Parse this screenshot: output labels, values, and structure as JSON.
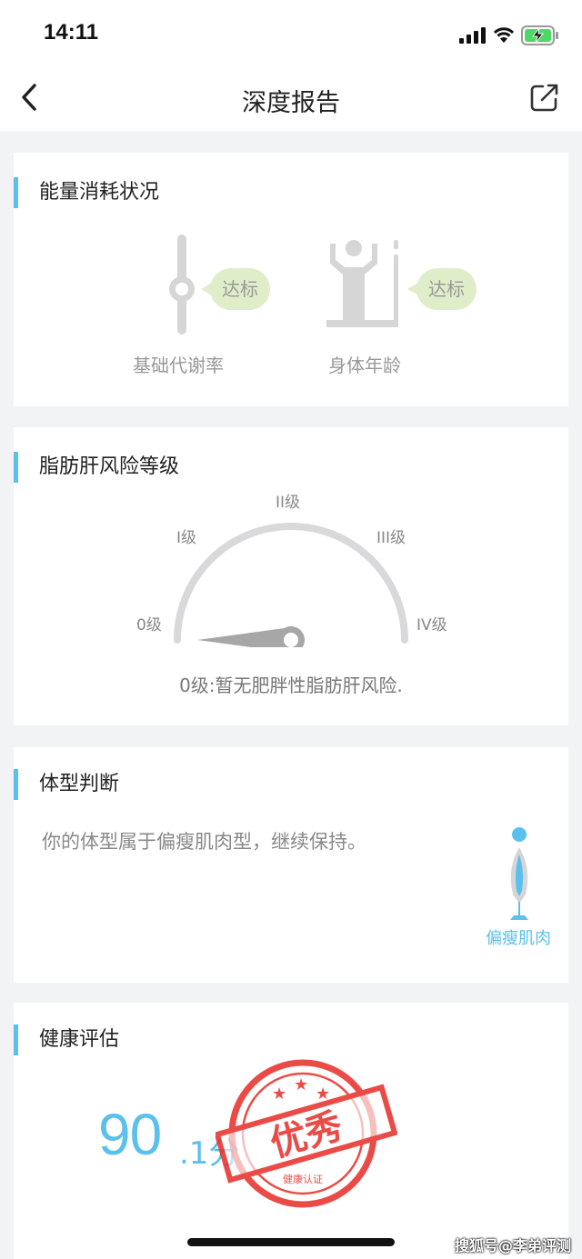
{
  "status_bar": {
    "time": "14:11"
  },
  "header": {
    "title": "深度报告"
  },
  "energy": {
    "title": "能量消耗状况",
    "items": [
      {
        "label": "基础代谢率",
        "status": "达标",
        "icon": "slider-icon"
      },
      {
        "label": "身体年龄",
        "status": "达标",
        "icon": "body-age-icon"
      }
    ]
  },
  "fatty_liver": {
    "title": "脂肪肝风险等级",
    "levels": [
      "0级",
      "I级",
      "II级",
      "III级",
      "IV级"
    ],
    "current_level_index": 0,
    "description": "0级:暂无肥胖性脂肪肝风险."
  },
  "body_type": {
    "title": "体型判断",
    "text": "你的体型属于偏瘦肌肉型，继续保持。",
    "type_label": "偏瘦肌肉"
  },
  "health": {
    "title": "健康评估",
    "score": "90",
    "score_unit": ".1分",
    "stamp_text": "优秀",
    "stamp_subtext": "健康认证"
  },
  "watermark": "搜狐号@李弟评测",
  "colors": {
    "accent": "#5bc0ec",
    "bubble": "#dfedc9",
    "stamp": "#e8332e"
  }
}
